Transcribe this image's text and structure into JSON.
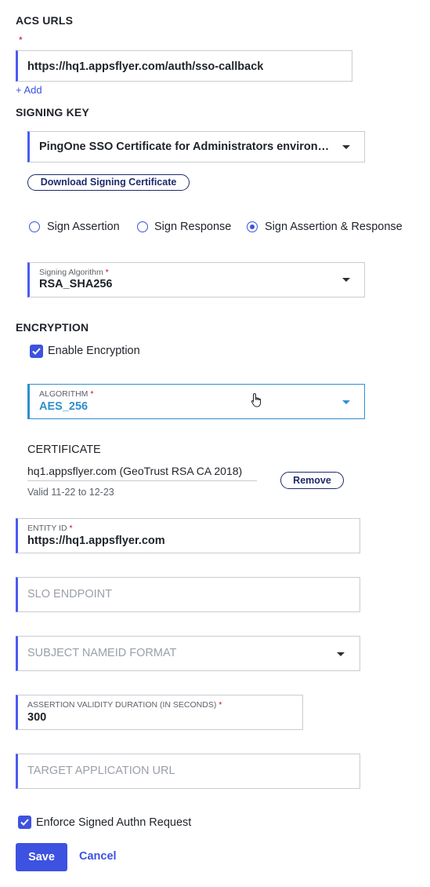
{
  "acs": {
    "title": "ACS URLS",
    "required_mark": "*",
    "url_value": "https://hq1.appsflyer.com/auth/sso-callback",
    "add_link": "+ Add"
  },
  "signing_key": {
    "title": "SIGNING KEY",
    "selected": "PingOne SSO Certificate for Administrators environ…",
    "download_button": "Download Signing Certificate",
    "radios": [
      {
        "label": "Sign Assertion",
        "checked": false
      },
      {
        "label": "Sign Response",
        "checked": false
      },
      {
        "label": "Sign Assertion & Response",
        "checked": true
      }
    ],
    "algorithm_label": "Signing Algorithm",
    "algorithm_required": "*",
    "algorithm_value": "RSA_SHA256"
  },
  "encryption": {
    "title": "ENCRYPTION",
    "enable_label": "Enable Encryption",
    "enable_checked": true,
    "algorithm_label": "ALGORITHM",
    "algorithm_required": "*",
    "algorithm_value": "AES_256",
    "certificate_title": "CERTIFICATE",
    "certificate_name": "hq1.appsflyer.com (GeoTrust RSA CA 2018)",
    "certificate_validity": "Valid 11-22 to 12-23",
    "remove_button": "Remove"
  },
  "entity_id": {
    "label": "ENTITY ID",
    "required": "*",
    "value": "https://hq1.appsflyer.com"
  },
  "slo_endpoint": {
    "placeholder": "SLO ENDPOINT"
  },
  "subject_nameid": {
    "placeholder": "SUBJECT NAMEID FORMAT"
  },
  "assertion_validity": {
    "label": "ASSERTION VALIDITY DURATION (IN SECONDS)",
    "required": "*",
    "value": "300"
  },
  "target_app_url": {
    "placeholder": "TARGET APPLICATION URL"
  },
  "enforce_signed": {
    "label": "Enforce Signed Authn Request",
    "checked": true
  },
  "actions": {
    "save": "Save",
    "cancel": "Cancel"
  },
  "colors": {
    "accent": "#3d52e0",
    "focus": "#2f8fd0",
    "required": "#d0021b"
  }
}
